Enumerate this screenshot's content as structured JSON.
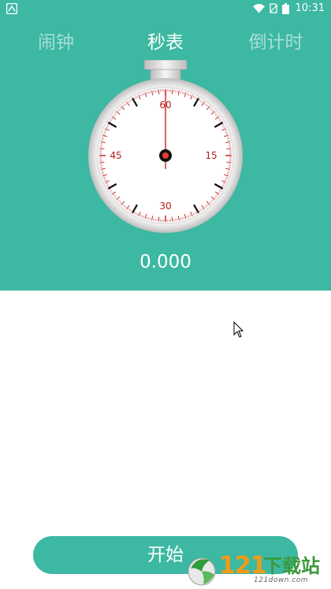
{
  "status_bar": {
    "time": "10:31"
  },
  "tabs": [
    {
      "label": "闹钟",
      "active": false
    },
    {
      "label": "秒表",
      "active": true
    },
    {
      "label": "倒计时",
      "active": false
    }
  ],
  "dial": {
    "labels": {
      "top": "60",
      "right": "15",
      "bottom": "30",
      "left": "45"
    }
  },
  "stopwatch": {
    "elapsed": "0.000"
  },
  "actions": {
    "start_label": "开始"
  },
  "watermark": {
    "text_num": "121",
    "text_cn": "下载站",
    "url": "121down.com"
  },
  "colors": {
    "accent": "#3db8a2",
    "hand": "#d32f2f",
    "tick": "#b71c1c",
    "white": "#ffffff"
  }
}
